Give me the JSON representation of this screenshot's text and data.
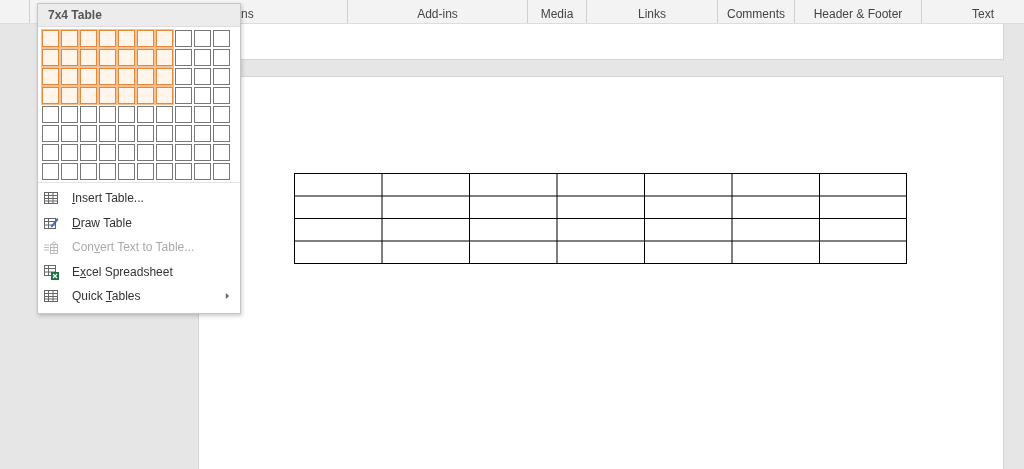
{
  "ribbon_groups": [
    {
      "label": "ns"
    },
    {
      "label": "Add-ins"
    },
    {
      "label": "Media"
    },
    {
      "label": "Links"
    },
    {
      "label": "Comments"
    },
    {
      "label": "Header & Footer"
    },
    {
      "label": "Text"
    }
  ],
  "table_menu": {
    "title": "7x4 Table",
    "grid": [
      {
        "cells": [
          {
            "selected": true
          },
          {
            "selected": true
          },
          {
            "selected": true
          },
          {
            "selected": true
          },
          {
            "selected": true
          },
          {
            "selected": true
          },
          {
            "selected": true
          },
          {
            "selected": false
          },
          {
            "selected": false
          },
          {
            "selected": false
          }
        ]
      },
      {
        "cells": [
          {
            "selected": true
          },
          {
            "selected": true
          },
          {
            "selected": true
          },
          {
            "selected": true
          },
          {
            "selected": true
          },
          {
            "selected": true
          },
          {
            "selected": true
          },
          {
            "selected": false
          },
          {
            "selected": false
          },
          {
            "selected": false
          }
        ]
      },
      {
        "cells": [
          {
            "selected": true
          },
          {
            "selected": true
          },
          {
            "selected": true
          },
          {
            "selected": true
          },
          {
            "selected": true
          },
          {
            "selected": true
          },
          {
            "selected": true
          },
          {
            "selected": false
          },
          {
            "selected": false
          },
          {
            "selected": false
          }
        ]
      },
      {
        "cells": [
          {
            "selected": true
          },
          {
            "selected": true
          },
          {
            "selected": true
          },
          {
            "selected": true
          },
          {
            "selected": true
          },
          {
            "selected": true
          },
          {
            "selected": true
          },
          {
            "selected": false
          },
          {
            "selected": false
          },
          {
            "selected": false
          }
        ]
      },
      {
        "cells": [
          {
            "selected": false
          },
          {
            "selected": false
          },
          {
            "selected": false
          },
          {
            "selected": false
          },
          {
            "selected": false
          },
          {
            "selected": false
          },
          {
            "selected": false
          },
          {
            "selected": false
          },
          {
            "selected": false
          },
          {
            "selected": false
          }
        ]
      },
      {
        "cells": [
          {
            "selected": false
          },
          {
            "selected": false
          },
          {
            "selected": false
          },
          {
            "selected": false
          },
          {
            "selected": false
          },
          {
            "selected": false
          },
          {
            "selected": false
          },
          {
            "selected": false
          },
          {
            "selected": false
          },
          {
            "selected": false
          }
        ]
      },
      {
        "cells": [
          {
            "selected": false
          },
          {
            "selected": false
          },
          {
            "selected": false
          },
          {
            "selected": false
          },
          {
            "selected": false
          },
          {
            "selected": false
          },
          {
            "selected": false
          },
          {
            "selected": false
          },
          {
            "selected": false
          },
          {
            "selected": false
          }
        ]
      },
      {
        "cells": [
          {
            "selected": false
          },
          {
            "selected": false
          },
          {
            "selected": false
          },
          {
            "selected": false
          },
          {
            "selected": false
          },
          {
            "selected": false
          },
          {
            "selected": false
          },
          {
            "selected": false
          },
          {
            "selected": false
          },
          {
            "selected": false
          }
        ]
      }
    ],
    "items": [
      {
        "kind": "insert",
        "key": "I",
        "post": "nsert Table...",
        "disabled": false,
        "submenu": false
      },
      {
        "kind": "draw",
        "key": "D",
        "post": "raw Table",
        "disabled": false,
        "submenu": false
      },
      {
        "kind": "convert",
        "pre": "Con",
        "key": "v",
        "post": "ert Text to Table...",
        "disabled": true,
        "submenu": false
      },
      {
        "kind": "excel",
        "pre": "E",
        "key": "x",
        "post": "cel Spreadsheet",
        "disabled": false,
        "submenu": false
      },
      {
        "kind": "quick",
        "pre": "Quick ",
        "key": "T",
        "post": "ables",
        "disabled": false,
        "submenu": true
      }
    ]
  }
}
